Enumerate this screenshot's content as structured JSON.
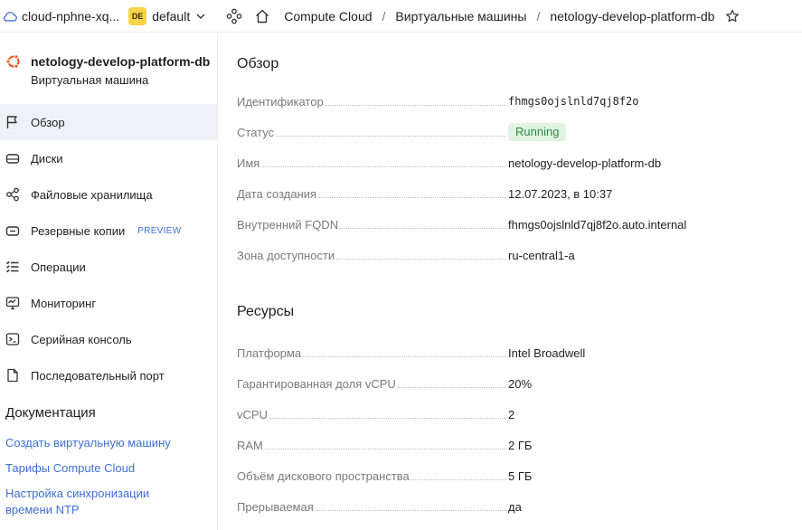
{
  "header": {
    "cloud_name": "cloud-nphne-xq...",
    "folder_badge": "DE",
    "folder_name": "default",
    "breadcrumbs": [
      "Compute Cloud",
      "Виртуальные машины"
    ],
    "current": "netology-develop-platform-db",
    "separator": "/"
  },
  "sidebar": {
    "vm_name": "netology-develop-platform-db",
    "vm_type": "Виртуальная машина",
    "items": [
      {
        "label": "Обзор",
        "icon": "flag-icon",
        "active": true
      },
      {
        "label": "Диски",
        "icon": "disk-icon"
      },
      {
        "label": "Файловые хранилища",
        "icon": "share-nodes-icon"
      },
      {
        "label": "Резервные копии",
        "icon": "backup-icon",
        "tag": "PREVIEW"
      },
      {
        "label": "Операции",
        "icon": "list-icon"
      },
      {
        "label": "Мониторинг",
        "icon": "monitor-icon"
      },
      {
        "label": "Серийная консоль",
        "icon": "terminal-icon"
      },
      {
        "label": "Последовательный порт",
        "icon": "file-icon"
      }
    ],
    "docs_title": "Документация",
    "docs_links": [
      "Создать виртуальную машину",
      "Тарифы Compute Cloud",
      "Настройка синхронизации времени NTP"
    ]
  },
  "overview": {
    "title": "Обзор",
    "rows": [
      {
        "key": "Идентификатор",
        "value": "fhmgs0ojslnld7qj8f2o"
      },
      {
        "key": "Статус",
        "value": "Running"
      },
      {
        "key": "Имя",
        "value": "netology-develop-platform-db"
      },
      {
        "key": "Дата создания",
        "value": "12.07.2023, в 10:37"
      },
      {
        "key": "Внутренний FQDN",
        "value": "fhmgs0ojslnld7qj8f2o.auto.internal"
      },
      {
        "key": "Зона доступности",
        "value": "ru-central1-a"
      }
    ]
  },
  "resources": {
    "title": "Ресурсы",
    "rows": [
      {
        "key": "Платформа",
        "value": "Intel Broadwell"
      },
      {
        "key": "Гарантированная доля vCPU",
        "value": "20%"
      },
      {
        "key": "vCPU",
        "value": "2"
      },
      {
        "key": "RAM",
        "value": "2 ГБ"
      },
      {
        "key": "Объём дискового пространства",
        "value": "5 ГБ"
      },
      {
        "key": "Прерываемая",
        "value": "да"
      }
    ]
  },
  "colors": {
    "accent_link": "#3f6fd8",
    "status_running_bg": "#e1f4e3",
    "status_running_fg": "#2e8a3c",
    "folder_badge_bg": "#f7d44a",
    "os_icon": "#e95420",
    "active_nav_bg": "#eef2f7"
  }
}
